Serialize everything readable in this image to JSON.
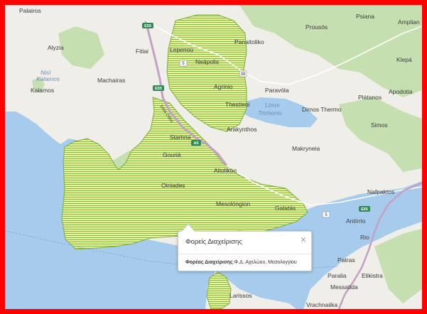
{
  "map": {
    "colors": {
      "land": "#efeee8",
      "sea": "#a6cbec",
      "lake": "#a6cbec",
      "forest": "#c6dfb0",
      "zone_fill": "#e4f29a",
      "zone_hatch": "#7cae3c",
      "frame": "#ff0000",
      "motorway": "#c69fc7"
    },
    "labels": {
      "palairos": "Palairos",
      "alyzia": "Alyzia",
      "fitiai": "Fitiai",
      "machairas": "Machairas",
      "nisi": "Nisí",
      "kalamos_island": "Kalamos",
      "kalamos": "Kalamos",
      "lepenou": "Lepenoú",
      "neapolis": "Neápolis",
      "agrinio": "Agrinio",
      "thestieoi": "Thestieoi",
      "panaitoliko": "Panaitoliko",
      "prousos": "Prousós",
      "psiana": "Psiana",
      "ampliani": "Amplian",
      "klepa": "Klepá",
      "paravola": "Paravóla",
      "platanos": "Plátanos",
      "apodotia": "Apodotia",
      "limni": "Limni",
      "trichonis": "Trichonis",
      "dimos_thermo": "Dimos Thermo",
      "simos": "Simos",
      "arakynthos": "Arakynthos",
      "stamna": "Stamna",
      "gouria": "Gouriá",
      "makryneia": "Makryneia",
      "aitolikon": "Aitolikón",
      "oiniades": "Oiniades",
      "nafpaktos": "Nafpaktos",
      "mesolongion": "Mesolóngion",
      "galatas": "Galatás",
      "antirrio": "Antírrio",
      "rio": "Rio",
      "patras": "Patras",
      "elikistra": "Elikistra",
      "paralia": "Paralia",
      "messatida": "Messatida",
      "larissos": "Larissos",
      "vrachnaiika": "Vrachnaiika",
      "ionia_odos": "Ionia Odos"
    },
    "shields": {
      "e55_north": "E55",
      "e55_mid": "E55",
      "a5": "A5",
      "r38": "38",
      "r5_top": "5",
      "r5_east": "5",
      "e65": "E65"
    }
  },
  "popup": {
    "title": "Φορείς Διαχείρισης",
    "close_symbol": "×",
    "body_label": "Φορέας Διαχείρισης",
    "body_value": ":Φ.Δ. Αχελώου, Μεσολογγίου"
  }
}
